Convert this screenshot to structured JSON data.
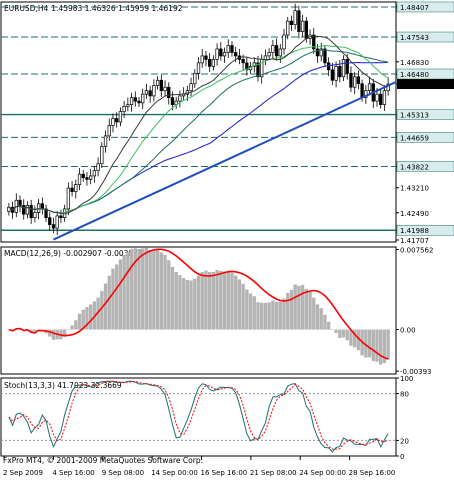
{
  "chart_data": {
    "type": "candlestick",
    "symbol": "EURUSD",
    "timeframe": "H4",
    "ohlc_header": "1.45983 1.46326 1.45959 1.46192",
    "current_price": "1.46192",
    "price_axis": {
      "range": [
        1.4165,
        1.4855
      ],
      "ticks": [
        "1.48407",
        "1.47543",
        "1.46830",
        "1.46480",
        "1.46192",
        "1.45313",
        "1.44659",
        "1.43822",
        "1.43210",
        "1.42490",
        "1.41988",
        "1.41707"
      ]
    },
    "horizontal_levels": [
      "1.48407",
      "1.47543",
      "1.46480",
      "1.45313",
      "1.44659",
      "1.43822",
      "1.41988"
    ],
    "price_closes": [
      1.4265,
      1.425,
      1.4285,
      1.427,
      1.4245,
      1.427,
      1.4235,
      1.425,
      1.4275,
      1.426,
      1.4235,
      1.4215,
      1.4205,
      1.424,
      1.4235,
      1.426,
      1.432,
      1.431,
      1.433,
      1.436,
      1.435,
      1.4345,
      1.4355,
      1.437,
      1.439,
      1.444,
      1.447,
      1.45,
      1.452,
      1.451,
      1.454,
      1.4555,
      1.456,
      1.458,
      1.457,
      1.4565,
      1.459,
      1.46,
      1.4585,
      1.4615,
      1.463,
      1.46,
      1.461,
      1.458,
      1.456,
      1.457,
      1.4585,
      1.459,
      1.46,
      1.462,
      1.465,
      1.468,
      1.47,
      1.469,
      1.467,
      1.469,
      1.472,
      1.47,
      1.471,
      1.473,
      1.471,
      1.47,
      1.469,
      1.468,
      1.466,
      1.467,
      1.468,
      1.464,
      1.469,
      1.47,
      1.471,
      1.473,
      1.47,
      1.472,
      1.476,
      1.48,
      1.479,
      1.483,
      1.477,
      1.48,
      1.475,
      1.476,
      1.472,
      1.47,
      1.472,
      1.468,
      1.466,
      1.463,
      1.467,
      1.464,
      1.469,
      1.465,
      1.461,
      1.464,
      1.462,
      1.458,
      1.46,
      1.462,
      1.457,
      1.459,
      1.456,
      1.46,
      1.4619
    ],
    "indicators": {
      "macd": {
        "label": "MACD(12,26,9) -0.002907 -0.003074",
        "ticks": [
          "0.007562",
          "0.00",
          "-0.00393"
        ],
        "range": [
          -0.0042,
          0.0078
        ]
      },
      "stoch": {
        "label": "Stoch(13,3,3) 41.7023 32.3669",
        "ticks": [
          "100",
          "80",
          "20",
          "0"
        ],
        "range": [
          0,
          100
        ]
      }
    },
    "x_axis": {
      "ticks": [
        "2 Sep 2009",
        "4 Sep 16:00",
        "9 Sep 08:00",
        "14 Sep 00:00",
        "16 Sep 16:00",
        "21 Sep 08:00",
        "24 Sep 00:00",
        "28 Sep 16:00"
      ]
    },
    "grid": false
  },
  "footer": "FxPro MT4, © 2001-2009 MetaQuotes Software Corp.",
  "colors": {
    "background": "#ffffff",
    "bull_candle": "#ffffff",
    "bear_candle": "#000000",
    "level_line": "#1f6f6f",
    "trendline": "#1f4fbf",
    "ma_fast": "#3cc05a",
    "ma_mid": "#1b6f62",
    "ma_slow": "#3a3a3a",
    "ma_blue": "#1f1fcf",
    "macd_hist": "#b4b4b4",
    "macd_signal": "#ff0000",
    "stoch_main": "#1f6f6f",
    "stoch_signal": "#ff0000",
    "current_price_box": "#000000"
  }
}
